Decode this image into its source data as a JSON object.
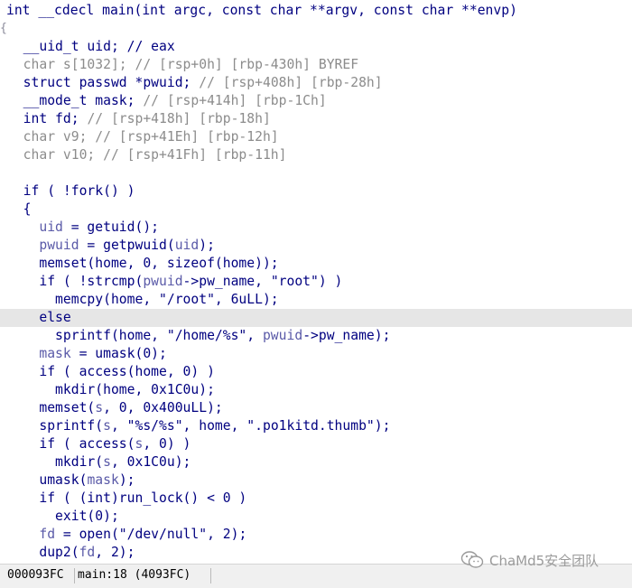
{
  "editor": {
    "lines": [
      {
        "gutter": "",
        "highlight": false,
        "segments": [
          {
            "t": "int __cdecl main(int argc, const char **argv, const char **envp)",
            "c": "k"
          }
        ]
      },
      {
        "gutter": "{",
        "highlight": false,
        "segments": []
      },
      {
        "gutter": "",
        "highlight": false,
        "segments": [
          {
            "t": "  __uid_t uid; // eax",
            "c": "k"
          }
        ]
      },
      {
        "gutter": "",
        "highlight": false,
        "segments": [
          {
            "t": "  char s[1032]; // [rsp+0h] [rbp-430h] BYREF",
            "c": "g"
          }
        ]
      },
      {
        "gutter": "",
        "highlight": false,
        "segments": [
          {
            "t": "  struct passwd *pwuid; ",
            "c": "k"
          },
          {
            "t": "// [rsp+408h] [rbp-28h]",
            "c": "g"
          }
        ]
      },
      {
        "gutter": "",
        "highlight": false,
        "segments": [
          {
            "t": "  __mode_t mask; ",
            "c": "k"
          },
          {
            "t": "// [rsp+414h] [rbp-1Ch]",
            "c": "g"
          }
        ]
      },
      {
        "gutter": "",
        "highlight": false,
        "segments": [
          {
            "t": "  int fd; ",
            "c": "k"
          },
          {
            "t": "// [rsp+418h] [rbp-18h]",
            "c": "g"
          }
        ]
      },
      {
        "gutter": "",
        "highlight": false,
        "segments": [
          {
            "t": "  char v9; // [rsp+41Eh] [rbp-12h]",
            "c": "g"
          }
        ]
      },
      {
        "gutter": "",
        "highlight": false,
        "segments": [
          {
            "t": "  char v10; // [rsp+41Fh] [rbp-11h]",
            "c": "g"
          }
        ]
      },
      {
        "gutter": "",
        "highlight": false,
        "segments": []
      },
      {
        "gutter": "",
        "highlight": false,
        "segments": [
          {
            "t": "  if ( !fork() )",
            "c": "k"
          }
        ]
      },
      {
        "gutter": "",
        "highlight": false,
        "segments": [
          {
            "t": "  {",
            "c": "k"
          }
        ]
      },
      {
        "gutter": "",
        "highlight": false,
        "segments": [
          {
            "t": "    ",
            "c": "k"
          },
          {
            "t": "uid",
            "c": "v"
          },
          {
            "t": " = getuid();",
            "c": "k"
          }
        ]
      },
      {
        "gutter": "",
        "highlight": false,
        "segments": [
          {
            "t": "    ",
            "c": "k"
          },
          {
            "t": "pwuid",
            "c": "v"
          },
          {
            "t": " = getpwuid(",
            "c": "k"
          },
          {
            "t": "uid",
            "c": "v"
          },
          {
            "t": ");",
            "c": "k"
          }
        ]
      },
      {
        "gutter": "",
        "highlight": false,
        "segments": [
          {
            "t": "    memset(home, 0, sizeof(home));",
            "c": "k"
          }
        ]
      },
      {
        "gutter": "",
        "highlight": false,
        "segments": [
          {
            "t": "    if ( !strcmp(",
            "c": "k"
          },
          {
            "t": "pwuid",
            "c": "v"
          },
          {
            "t": "->pw_name, \"root\") )",
            "c": "k"
          }
        ]
      },
      {
        "gutter": "",
        "highlight": false,
        "segments": [
          {
            "t": "      memcpy(home, \"/root\", 6uLL);",
            "c": "k"
          }
        ]
      },
      {
        "gutter": "",
        "highlight": true,
        "segments": [
          {
            "t": "    else",
            "c": "k"
          }
        ]
      },
      {
        "gutter": "",
        "highlight": false,
        "segments": [
          {
            "t": "      sprintf(home, \"/home/%s\", ",
            "c": "k"
          },
          {
            "t": "pwuid",
            "c": "v"
          },
          {
            "t": "->pw_name);",
            "c": "k"
          }
        ]
      },
      {
        "gutter": "",
        "highlight": false,
        "segments": [
          {
            "t": "    ",
            "c": "k"
          },
          {
            "t": "mask",
            "c": "v"
          },
          {
            "t": " = umask(0);",
            "c": "k"
          }
        ]
      },
      {
        "gutter": "",
        "highlight": false,
        "segments": [
          {
            "t": "    if ( access(home, 0) )",
            "c": "k"
          }
        ]
      },
      {
        "gutter": "",
        "highlight": false,
        "segments": [
          {
            "t": "      mkdir(home, 0x1C0u);",
            "c": "k"
          }
        ]
      },
      {
        "gutter": "",
        "highlight": false,
        "segments": [
          {
            "t": "    memset(",
            "c": "k"
          },
          {
            "t": "s",
            "c": "v"
          },
          {
            "t": ", 0, 0x400uLL);",
            "c": "k"
          }
        ]
      },
      {
        "gutter": "",
        "highlight": false,
        "segments": [
          {
            "t": "    sprintf(",
            "c": "k"
          },
          {
            "t": "s",
            "c": "v"
          },
          {
            "t": ", \"%s/%s\", home, \".po1kitd.thumb\");",
            "c": "k"
          }
        ]
      },
      {
        "gutter": "",
        "highlight": false,
        "segments": [
          {
            "t": "    if ( access(",
            "c": "k"
          },
          {
            "t": "s",
            "c": "v"
          },
          {
            "t": ", 0) )",
            "c": "k"
          }
        ]
      },
      {
        "gutter": "",
        "highlight": false,
        "segments": [
          {
            "t": "      mkdir(",
            "c": "k"
          },
          {
            "t": "s",
            "c": "v"
          },
          {
            "t": ", 0x1C0u);",
            "c": "k"
          }
        ]
      },
      {
        "gutter": "",
        "highlight": false,
        "segments": [
          {
            "t": "    umask(",
            "c": "k"
          },
          {
            "t": "mask",
            "c": "v"
          },
          {
            "t": ");",
            "c": "k"
          }
        ]
      },
      {
        "gutter": "",
        "highlight": false,
        "segments": [
          {
            "t": "    if ( (int)run_lock() < 0 )",
            "c": "k"
          }
        ]
      },
      {
        "gutter": "",
        "highlight": false,
        "segments": [
          {
            "t": "      exit(0);",
            "c": "k"
          }
        ]
      },
      {
        "gutter": "",
        "highlight": false,
        "segments": [
          {
            "t": "    ",
            "c": "k"
          },
          {
            "t": "fd",
            "c": "v"
          },
          {
            "t": " = open(\"/dev/null\", 2);",
            "c": "k"
          }
        ]
      },
      {
        "gutter": "",
        "highlight": false,
        "segments": [
          {
            "t": "    dup2(",
            "c": "k"
          },
          {
            "t": "fd",
            "c": "v"
          },
          {
            "t": ", 2);",
            "c": "k"
          }
        ]
      }
    ]
  },
  "status_bar": {
    "address": "000093FC",
    "location": "main:18 (4093FC)"
  },
  "watermark": {
    "text": "ChaMd5安全团队",
    "icon": "wechat-icon"
  },
  "colors": {
    "code": "#000080",
    "comment": "#8c8c8c",
    "variable": "#5a5aa8",
    "highlight": "#e6e6e6"
  }
}
